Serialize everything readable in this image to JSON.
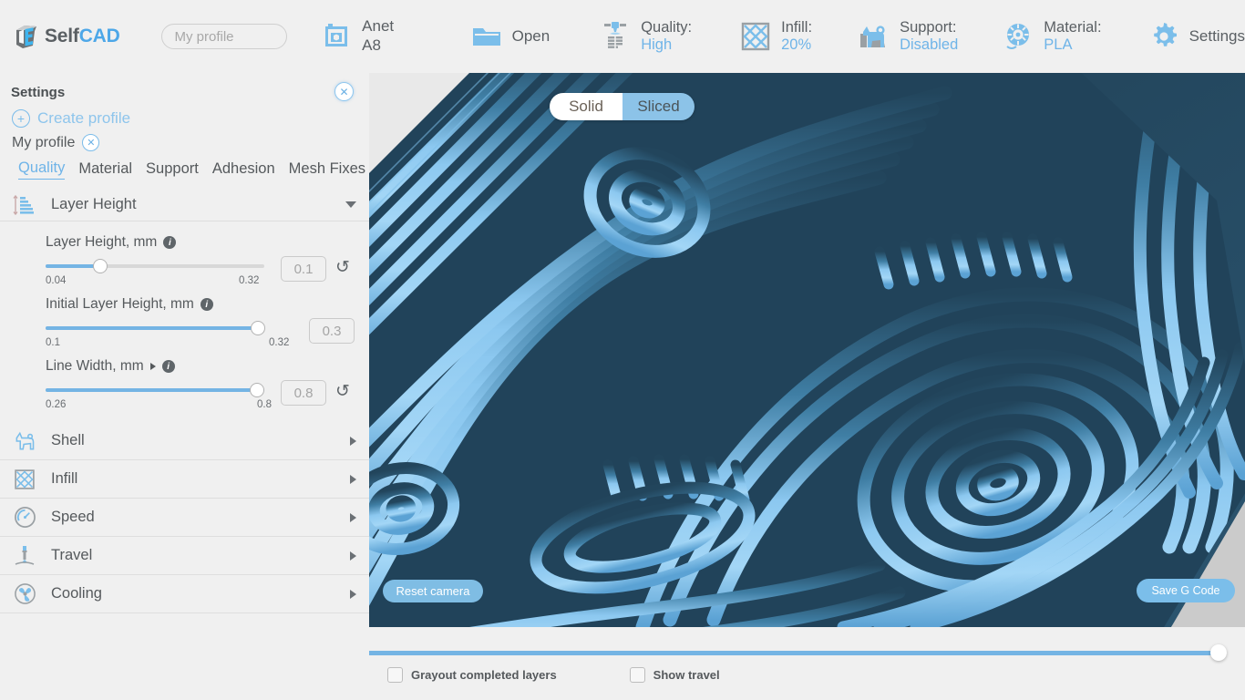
{
  "app": {
    "logo_self": "Self",
    "logo_cad": "CAD",
    "accent_blue": "#74b4e4",
    "text_gray": "#55595c",
    "panel_bg": "#f0f0f0"
  },
  "topbar": {
    "profile_placeholder": "My profile",
    "items": [
      {
        "id": "printer",
        "icon": "printer-icon",
        "label": "Anet A8",
        "value": ""
      },
      {
        "id": "open",
        "icon": "folder-icon",
        "label": "Open",
        "value": ""
      },
      {
        "id": "quality",
        "icon": "nozzle-icon",
        "label": "Quality:",
        "value": "High"
      },
      {
        "id": "infill",
        "icon": "infill-icon",
        "label": "Infill:",
        "value": "20%"
      },
      {
        "id": "support",
        "icon": "support-dog-icon",
        "label": "Support:",
        "value": "Disabled"
      },
      {
        "id": "material",
        "icon": "spool-icon",
        "label": "Material:",
        "value": "PLA"
      },
      {
        "id": "settings",
        "icon": "gear-icon",
        "label": "Settings",
        "value": ""
      }
    ]
  },
  "sidebar": {
    "title": "Settings",
    "close_label": "✕",
    "create_profile": "Create profile",
    "profile_name": "My profile",
    "profile_remove_label": "✕",
    "tabs": [
      {
        "label": "Quality",
        "active": true
      },
      {
        "label": "Material",
        "active": false
      },
      {
        "label": "Support",
        "active": false
      },
      {
        "label": "Adhesion",
        "active": false
      },
      {
        "label": "Mesh Fixes",
        "active": false
      }
    ],
    "open_section": {
      "label": "Layer Height",
      "icon": "layer-height-icon",
      "params": [
        {
          "label": "Layer Height, mm",
          "value": "0.1",
          "min": "0.04",
          "max": "0.32",
          "fill_pct": 25,
          "has_reset": true,
          "has_expand": false
        },
        {
          "label": "Initial Layer Height, mm",
          "value": "0.3",
          "min": "0.1",
          "max": "0.32",
          "fill_pct": 89,
          "has_reset": false,
          "has_expand": false
        },
        {
          "label": "Line Width, mm",
          "value": "0.8",
          "min": "0.26",
          "max": "0.8",
          "fill_pct": 100,
          "has_reset": true,
          "has_expand": true
        }
      ]
    },
    "sections": [
      {
        "label": "Shell",
        "icon": "shell-dog-icon"
      },
      {
        "label": "Infill",
        "icon": "infill-icon"
      },
      {
        "label": "Speed",
        "icon": "speedometer-icon"
      },
      {
        "label": "Travel",
        "icon": "travel-icon"
      },
      {
        "label": "Cooling",
        "icon": "fan-icon"
      }
    ]
  },
  "viewport": {
    "toggle": {
      "solid": "Solid",
      "sliced": "Sliced",
      "selected": "Solid"
    },
    "reset_camera": "Reset camera",
    "save_gcode": "Save G Code",
    "model_color": "#7dc0ec",
    "model_shadow": "#234256",
    "background": "#cfcfcf"
  },
  "bottombar": {
    "layer_slider_pct": 100,
    "checkboxes": [
      {
        "label": "Grayout completed layers",
        "checked": false
      },
      {
        "label": "Show travel",
        "checked": false
      }
    ]
  }
}
